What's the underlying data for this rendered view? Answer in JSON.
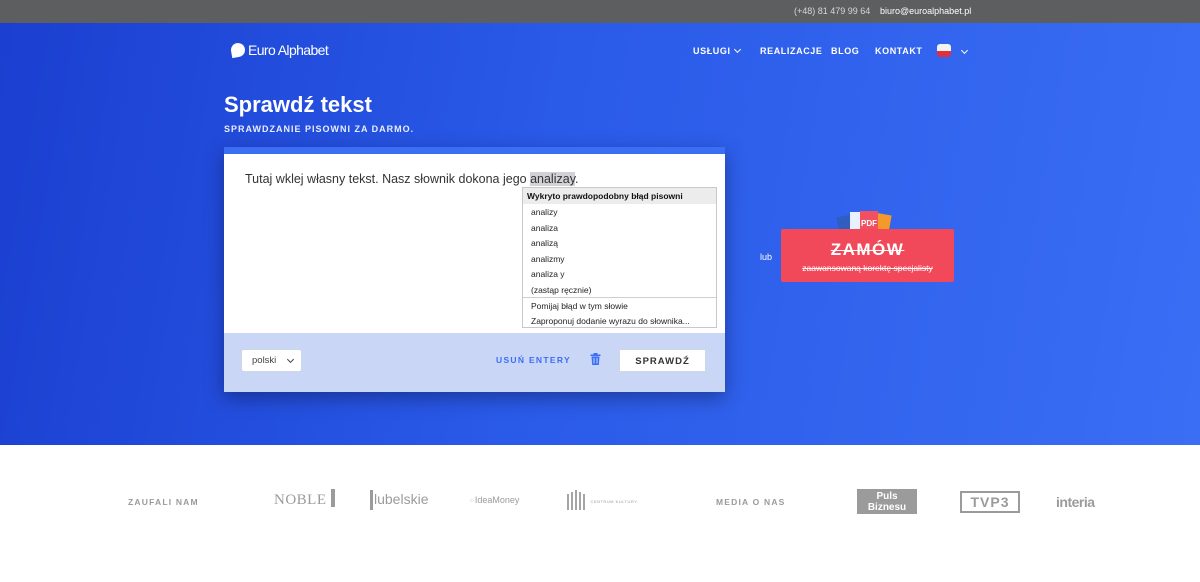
{
  "topbar": {
    "phone": "(+48) 81 479 99 64",
    "email": "biuro@euroalphabet.pl"
  },
  "header": {
    "logo_text": "Euro Alphabet",
    "nav": [
      {
        "label": "USŁUGI",
        "has_dropdown": true
      },
      {
        "label": "REALIZACJE"
      },
      {
        "label": "BLOG"
      },
      {
        "label": "KONTAKT"
      }
    ],
    "language_flag": "pl-flag-icon"
  },
  "hero": {
    "title": "Sprawdź tekst",
    "subtitle": "SPRAWDZANIE PISOWNI ZA DARMO."
  },
  "editor": {
    "text_before": "Tutaj wklej własny tekst. Nasz słownik dokona jego ",
    "misspelled_word": "analizay",
    "text_after": ".",
    "spellcheck_popup": {
      "header": "Wykryto prawdopodobny błąd pisowni",
      "suggestions": [
        "analizy",
        "analiza",
        "analizą",
        "analizmy",
        "analiza y",
        "(zastąp ręcznie)"
      ],
      "actions": [
        "Pomijaj błąd w tym słowie",
        "Zaproponuj dodanie wyrazu do słownika..."
      ]
    },
    "language_selected": "polski",
    "remove_enters_label": "USUŃ ENTERY",
    "check_button": "SPRAWDŹ"
  },
  "cta": {
    "or_label": "lub",
    "button_title": "ZAMÓW",
    "button_subtitle": "zaawansowaną korektę specjalisty",
    "pdf_label": "PDF"
  },
  "trust": {
    "trusted_label": "ZAUFALI NAM",
    "media_label": "MEDIA O NAS",
    "clients": [
      "NOBLE",
      "lubelskie",
      "IdeaMoney",
      "CENTRUM KULTURY"
    ],
    "media": [
      "Puls Biznesu",
      "TVP3",
      "interia"
    ]
  },
  "colors": {
    "hero": "#2a5ae8",
    "accent": "#3a6ef5",
    "cta": "#f1485a",
    "topbar": "#5d5e60"
  }
}
